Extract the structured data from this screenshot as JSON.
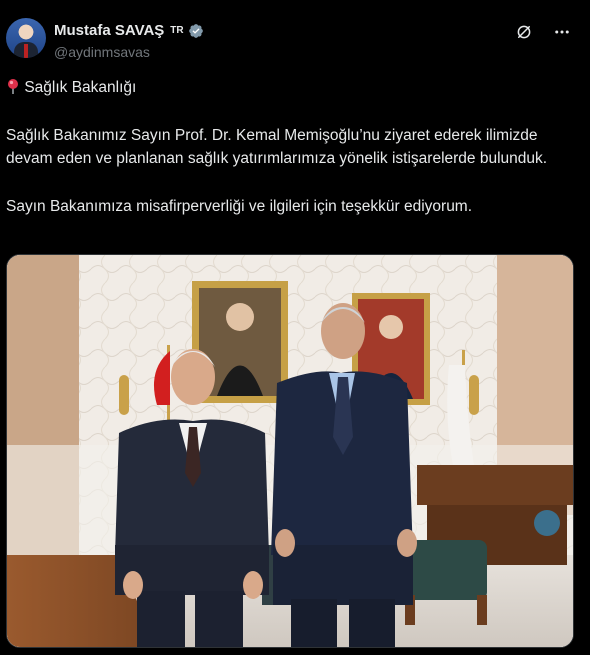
{
  "user": {
    "name": "Mustafa SAVAŞ",
    "flag_label": "TR",
    "handle": "@aydinmsavas"
  },
  "tweet": {
    "location_line": "Sağlık Bakanlığı",
    "paragraph1": "Sağlık Bakanımız Sayın Prof. Dr. Kemal Memişoğlu’nu ziyaret ederek ilimizde devam eden ve planlanan sağlık yatırımlarımıza yönelik istişarelerde bulunduk.",
    "paragraph2": "Sayın Bakanımıza misafirperverliği ve ilgileri için teşekkür ediyorum."
  },
  "icons": {
    "verified": "verified-badge-icon",
    "grok": "grok-icon",
    "more": "more-icon",
    "pin": "round-pushpin-icon"
  },
  "colors": {
    "background": "#000000",
    "text": "#e7e9ea",
    "secondary": "#71767b",
    "verified_badge": "#829aab"
  }
}
